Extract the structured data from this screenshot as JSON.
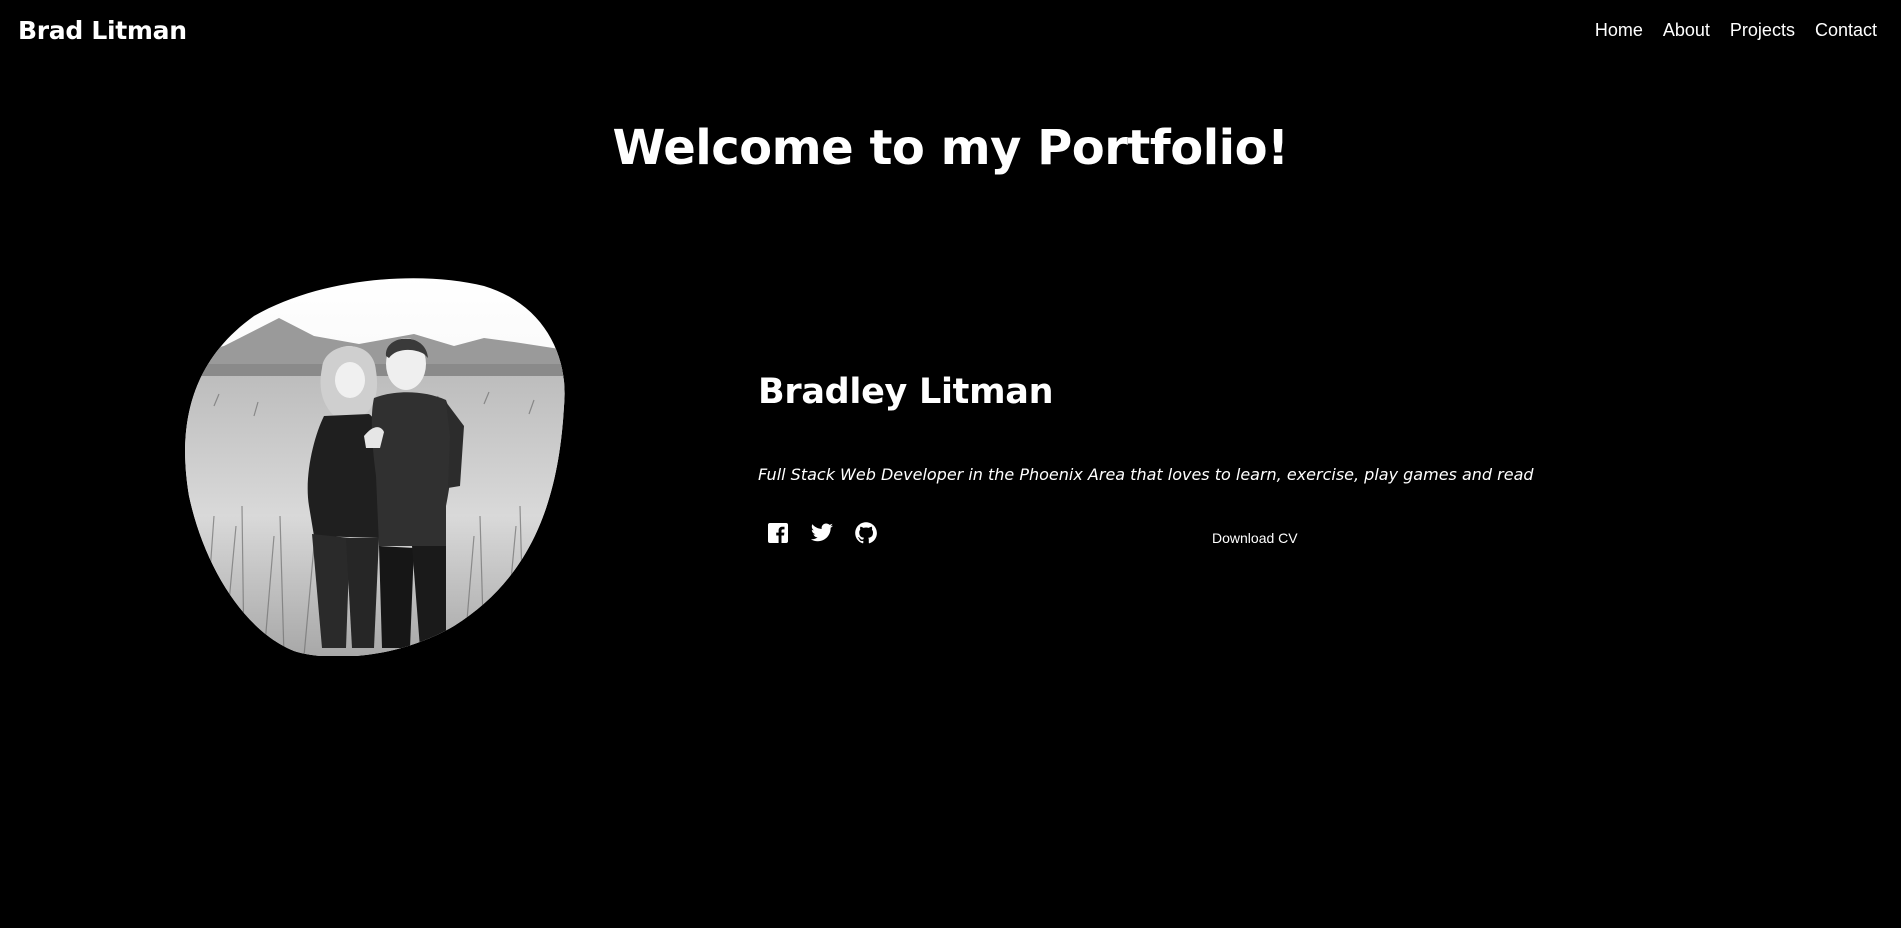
{
  "header": {
    "brand": "Brad Litman",
    "nav": [
      {
        "label": "Home"
      },
      {
        "label": "About"
      },
      {
        "label": "Projects"
      },
      {
        "label": "Contact"
      }
    ]
  },
  "hero": {
    "title": "Welcome to my Portfolio!"
  },
  "profile": {
    "photo_icon": "profile-photo",
    "name": "Bradley Litman",
    "tagline": "Full Stack Web Developer in the Phoenix Area that loves to learn, exercise, play games and read",
    "socials": [
      {
        "icon": "facebook-icon"
      },
      {
        "icon": "twitter-icon"
      },
      {
        "icon": "github-icon"
      }
    ],
    "download_cv_label": "Download CV"
  },
  "colors": {
    "background": "#000000",
    "text": "#ffffff"
  }
}
